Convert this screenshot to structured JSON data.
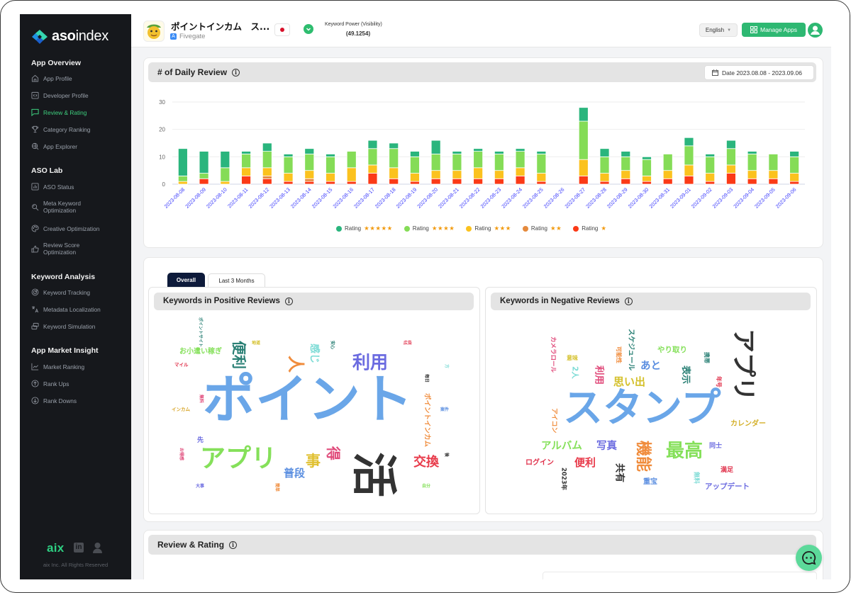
{
  "theme": {
    "accent": "#2eb872",
    "sidebar_bg": "#16181c",
    "active_nav": "#3ecf7e",
    "tab_active_bg": "#0d1a3a"
  },
  "sidebar": {
    "logo": {
      "bold": "aso",
      "light": "index"
    },
    "sections": [
      {
        "title": "App Overview",
        "items": [
          {
            "label": "App Profile",
            "icon": "home-icon"
          },
          {
            "label": "Developer Profile",
            "icon": "code-icon"
          },
          {
            "label": "Review & Rating",
            "icon": "chat-bubble-icon",
            "active": true
          },
          {
            "label": "Category Ranking",
            "icon": "trophy-icon"
          },
          {
            "label": "App Explorer",
            "icon": "globe-search-icon"
          }
        ]
      },
      {
        "title": "ASO Lab",
        "items": [
          {
            "label": "ASO Status",
            "icon": "bar-chart-icon"
          },
          {
            "label": "Meta Keyword Optimization",
            "icon": "search-refresh-icon"
          },
          {
            "label": "Creative Optimization",
            "icon": "palette-icon"
          },
          {
            "label": "Review Score Optimization",
            "icon": "thumbs-up-icon"
          }
        ]
      },
      {
        "title": "Keyword Analysis",
        "items": [
          {
            "label": "Keyword Tracking",
            "icon": "target-icon"
          },
          {
            "label": "Metadata Localization",
            "icon": "translate-icon"
          },
          {
            "label": "Keyword Simulation",
            "icon": "layers-icon"
          }
        ]
      },
      {
        "title": "App Market Insight",
        "items": [
          {
            "label": "Market Ranking",
            "icon": "line-chart-icon"
          },
          {
            "label": "Rank Ups",
            "icon": "arrow-up-circle-icon"
          },
          {
            "label": "Rank Downs",
            "icon": "arrow-down-circle-icon"
          }
        ]
      }
    ],
    "footer": {
      "brand": "aix",
      "linkedin": "in",
      "copyright": "aix Inc. All Rights Reserved"
    }
  },
  "header": {
    "app_title": "ポイントインカム　ス...",
    "developer": "Fivegate",
    "country_flag": "japan-flag",
    "keyword_power_label": "Keyword Power (Visibility)",
    "keyword_power_value": "(49.1254)",
    "language": "English",
    "manage_apps": "Manage Apps"
  },
  "daily_review": {
    "title": "# of Daily Review",
    "date_range": "Date 2023.08.08 - 2023.09.06"
  },
  "chart_data": {
    "type": "bar",
    "stacked": true,
    "title": "# of Daily Review",
    "xlabel": "",
    "ylabel": "",
    "ylim": [
      0,
      30
    ],
    "yticks": [
      0,
      10,
      20,
      30
    ],
    "grid": true,
    "legend_position": "bottom",
    "categories": [
      "2023-08-08",
      "2023-08-09",
      "2023-08-10",
      "2023-08-11",
      "2023-08-12",
      "2023-08-13",
      "2023-08-14",
      "2023-08-15",
      "2023-08-16",
      "2023-08-17",
      "2023-08-18",
      "2023-08-19",
      "2023-08-20",
      "2023-08-21",
      "2023-08-22",
      "2023-08-23",
      "2023-08-24",
      "2023-08-25",
      "2023-08-26",
      "2023-08-27",
      "2023-08-28",
      "2023-08-29",
      "2023-08-30",
      "2023-08-31",
      "2023-09-01",
      "2023-09-02",
      "2023-09-03",
      "2023-09-04",
      "2023-09-05",
      "2023-09-06"
    ],
    "series": [
      {
        "name": "Rating ★★★★★",
        "label": "Rating",
        "stars": "★★★★★",
        "color": "#2ab57d",
        "values": [
          10,
          8,
          6,
          1,
          3,
          1,
          2,
          1,
          0,
          3,
          2,
          2,
          5,
          1,
          1,
          1,
          1,
          1,
          0,
          5,
          3,
          2,
          1,
          0,
          3,
          1,
          3,
          1,
          0,
          2
        ]
      },
      {
        "name": "Rating ★★★★",
        "label": "Rating",
        "stars": "★★★★",
        "color": "#85dc57",
        "values": [
          2,
          2,
          5,
          5,
          6,
          6,
          6,
          6,
          6,
          6,
          7,
          6,
          6,
          6,
          6,
          6,
          6,
          7,
          0,
          14,
          6,
          5,
          6,
          6,
          7,
          6,
          6,
          6,
          6,
          6
        ]
      },
      {
        "name": "Rating ★★★",
        "label": "Rating",
        "stars": "★★★",
        "color": "#fbc21e",
        "values": [
          1,
          0,
          1,
          3,
          3,
          3,
          3,
          3,
          5,
          3,
          4,
          3,
          3,
          3,
          4,
          3,
          3,
          3,
          0,
          6,
          3,
          3,
          2,
          3,
          4,
          3,
          3,
          3,
          3,
          3
        ]
      },
      {
        "name": "Rating ★★",
        "label": "Rating",
        "stars": "★★",
        "color": "#e58a3d",
        "values": [
          0,
          0,
          0,
          0,
          1,
          0,
          1,
          0,
          0,
          0,
          0,
          0,
          0,
          0,
          0,
          0,
          0,
          0,
          0,
          0,
          0,
          0,
          0,
          0,
          0,
          0,
          0,
          0,
          0,
          0
        ]
      },
      {
        "name": "Rating ★",
        "label": "Rating",
        "stars": "★",
        "color": "#fb3a17",
        "values": [
          0,
          2,
          0,
          3,
          2,
          1,
          1,
          1,
          1,
          4,
          2,
          1,
          2,
          2,
          2,
          2,
          3,
          1,
          0,
          3,
          1,
          2,
          1,
          2,
          3,
          1,
          4,
          2,
          2,
          1
        ]
      }
    ]
  },
  "keywords": {
    "tabs": [
      {
        "label": "Overall",
        "active": true
      },
      {
        "label": "Last 3 Months",
        "active": false
      }
    ],
    "positive": {
      "title": "Keywords in Positive Reviews",
      "words": [
        "ポイント",
        "活",
        "アプリ",
        "利用",
        "便利",
        "人",
        "感じ",
        "お小遣い稼ぎ",
        "交換",
        "得",
        "事",
        "普段",
        "ポイントインカム",
        "ポイントサイト",
        "マイル",
        "インカム",
        "先",
        "地道",
        "安心",
        "広告",
        "無料",
        "お得感",
        "大事",
        "簡単",
        "案件",
        "方",
        "毎日",
        "後",
        "自分"
      ]
    },
    "negative": {
      "title": "Keywords in Negative Reviews",
      "words": [
        "スタンプ",
        "アプリ",
        "最高",
        "機能",
        "アルバム",
        "写真",
        "便利",
        "思い出",
        "利用",
        "表示",
        "あと",
        "共有",
        "ログイン",
        "2023年",
        "重宝",
        "やり取り",
        "2人",
        "スケジュール",
        "カメラロール",
        "アイコン",
        "カレンダー",
        "アップデート",
        "同士",
        "満足",
        "無料",
        "年号",
        "携帯",
        "可能性",
        "意味"
      ]
    }
  },
  "review_rating": {
    "title": "Review & Rating"
  },
  "info_glyph": "i"
}
